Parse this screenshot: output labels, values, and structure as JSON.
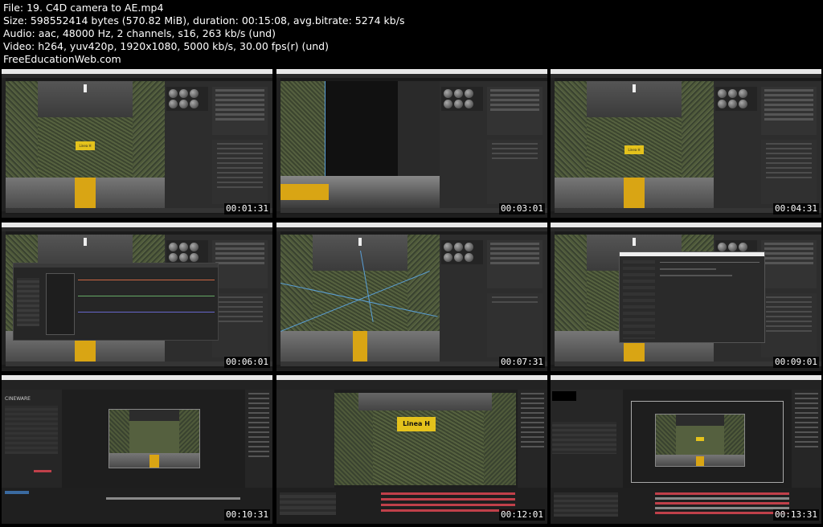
{
  "header": {
    "line1": "File: 19. C4D camera to AE.mp4",
    "line2": "Size: 598552414 bytes (570.82 MiB), duration: 00:15:08, avg.bitrate: 5274 kb/s",
    "line3": "Audio: aac, 48000 Hz, 2 channels, s16, 263 kb/s (und)",
    "line4": "Video: h264, yuv420p, 1920x1080, 5000 kb/s, 30.00 fps(r) (und)",
    "line5": "FreeEducationWeb.com"
  },
  "thumbnails": [
    {
      "timestamp": "00:01:31",
      "app": "cinema4d",
      "sign": "Linea H"
    },
    {
      "timestamp": "00:03:01",
      "app": "cinema4d",
      "sign": ""
    },
    {
      "timestamp": "00:04:31",
      "app": "cinema4d",
      "sign": "Linea H"
    },
    {
      "timestamp": "00:06:01",
      "app": "cinema4d",
      "sign": ""
    },
    {
      "timestamp": "00:07:31",
      "app": "cinema4d",
      "sign": ""
    },
    {
      "timestamp": "00:09:01",
      "app": "cinema4d",
      "sign": ""
    },
    {
      "timestamp": "00:10:31",
      "app": "after-effects",
      "sign": "",
      "logo": "CINEWARE"
    },
    {
      "timestamp": "00:12:01",
      "app": "after-effects",
      "sign": "Linea H"
    },
    {
      "timestamp": "00:13:31",
      "app": "after-effects",
      "sign": ""
    }
  ],
  "colors": {
    "background": "#000000",
    "sign_yellow": "#e4c21c",
    "floor_stripe": "#d9a514",
    "timeline_red": "#c0404a",
    "timeline_green": "#6a9a5a"
  }
}
